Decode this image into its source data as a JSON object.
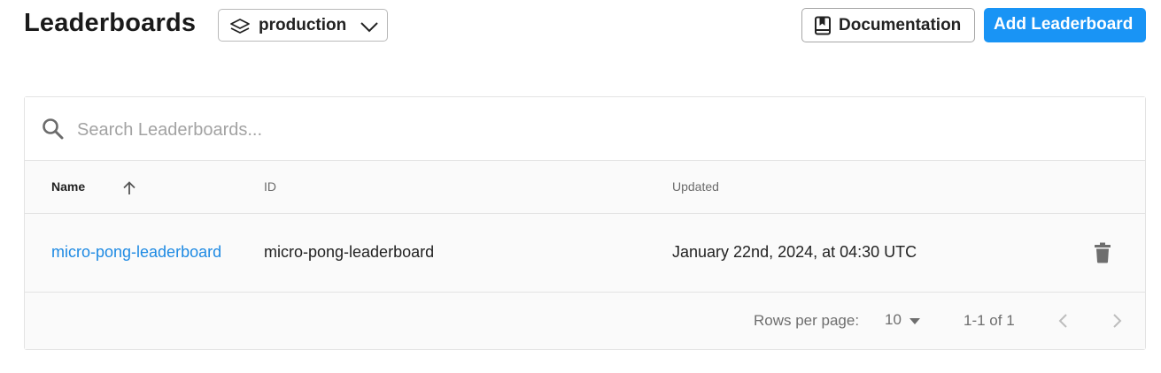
{
  "header": {
    "title": "Leaderboards",
    "environment": {
      "value": "production",
      "icon": "layers-icon"
    },
    "documentation_label": "Documentation",
    "add_label": "Add Leaderboard",
    "accent_color": "#1994f5"
  },
  "search": {
    "placeholder": "Search Leaderboards...",
    "value": ""
  },
  "table": {
    "columns": [
      {
        "label": "Name",
        "sorted": "ascending"
      },
      {
        "label": "ID"
      },
      {
        "label": "Updated"
      }
    ],
    "rows": [
      {
        "name": "micro-pong-leaderboard",
        "id": "micro-pong-leaderboard",
        "updated": "January 22nd, 2024, at 04:30 UTC",
        "action_icon": "trash-icon"
      }
    ]
  },
  "pagination": {
    "rows_per_page_label": "Rows per page:",
    "rows_per_page": "10",
    "range": "1-1 of 1"
  }
}
